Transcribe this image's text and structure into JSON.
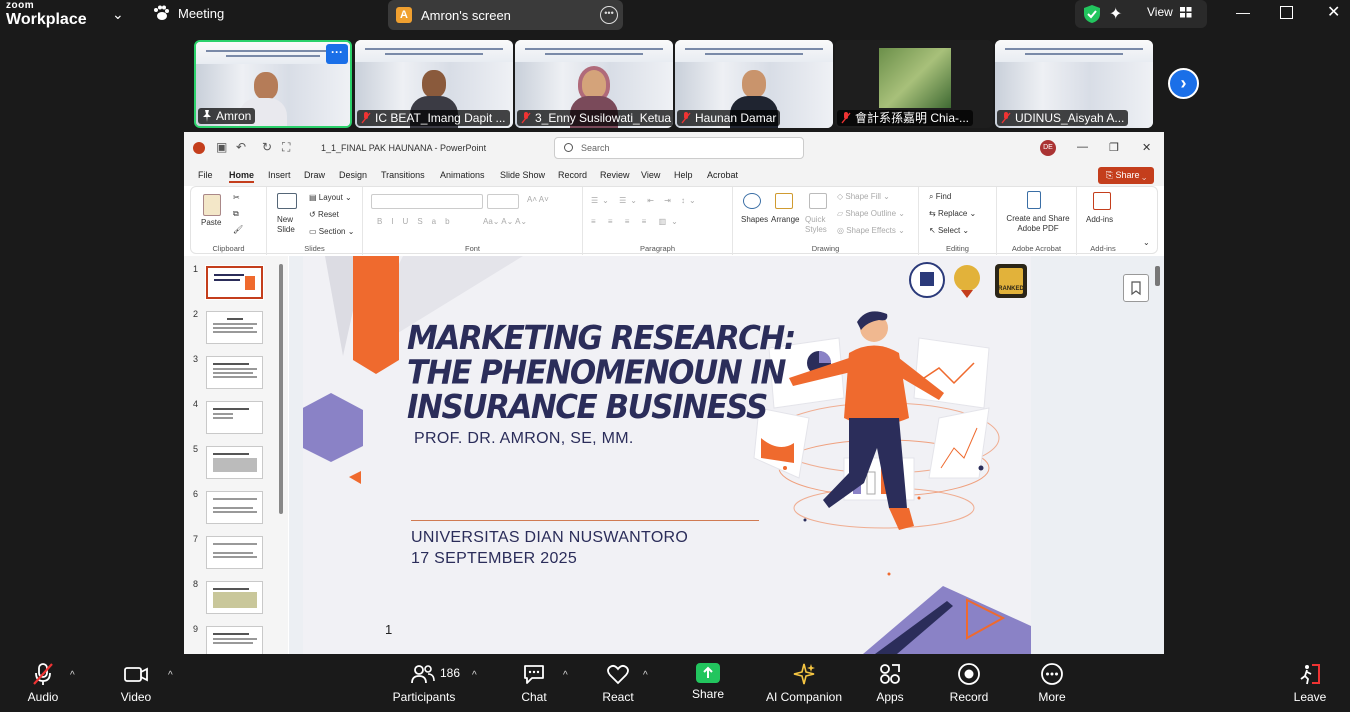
{
  "topbar": {
    "brand_small": "zoom",
    "brand_large": "Workplace",
    "meeting_label": "Meeting",
    "screen_avatar_letter": "A",
    "screen_label": "Amron's screen",
    "view_label": "View"
  },
  "participants": [
    {
      "name": "Amron",
      "pinned": true,
      "active": true
    },
    {
      "name": "IC BEAT_Imang Dapit ...",
      "muted": true
    },
    {
      "name": "3_Enny Susilowati_Ketua ...",
      "muted": true
    },
    {
      "name": "Haunan Damar",
      "muted": true
    },
    {
      "name": "會計系孫嘉明 Chia-...",
      "muted": true
    },
    {
      "name": "UDINUS_Aisyah A...",
      "muted": true
    }
  ],
  "active_menu_symbol": "···",
  "powerpoint": {
    "filename": "1_1_FINAL PAK HAUNANA  -  PowerPoint",
    "search_placeholder": "Search",
    "user_initials": "DE",
    "share_label": "Share",
    "menu_tabs": [
      "File",
      "Home",
      "Insert",
      "Draw",
      "Design",
      "Transitions",
      "Animations",
      "Slide Show",
      "Record",
      "Review",
      "View",
      "Help",
      "Acrobat"
    ],
    "ribbon": {
      "paste": "Paste",
      "clipboard": "Clipboard",
      "new_slide": "New Slide",
      "layout": "Layout",
      "reset": "Reset",
      "section": "Section",
      "slides": "Slides",
      "font": "Font",
      "paragraph": "Paragraph",
      "shapes": "Shapes",
      "arrange": "Arrange",
      "quick_styles": "Quick Styles",
      "shape_fill": "Shape Fill",
      "shape_outline": "Shape Outline",
      "shape_effects": "Shape Effects",
      "drawing": "Drawing",
      "find": "Find",
      "replace": "Replace",
      "select": "Select",
      "editing": "Editing",
      "create_share": "Create and Share Adobe PDF",
      "adobe_acrobat": "Adobe Acrobat",
      "add_ins": "Add-ins",
      "add_ins_group": "Add-ins"
    },
    "slide_numbers": [
      "1",
      "2",
      "3",
      "4",
      "5",
      "6",
      "7",
      "8",
      "9"
    ],
    "slide": {
      "title": "MARKETING RESEARCH: THE PHENOMENOUN IN INSURANCE BUSINESS",
      "author": "PROF. DR. AMRON, SE, MM.",
      "university": "UNIVERSITAS DIAN NUSWANTORO",
      "date": "17 SEPTEMBER 2025",
      "page": "1",
      "badge_text": "RANKED"
    }
  },
  "toolbar": {
    "audio": "Audio",
    "video": "Video",
    "participants": "Participants",
    "participants_count": "186",
    "chat": "Chat",
    "react": "React",
    "share": "Share",
    "ai_companion": "AI Companion",
    "apps": "Apps",
    "record": "Record",
    "more": "More",
    "leave": "Leave"
  },
  "colors": {
    "zoom_blue": "#1a6fe8",
    "active_green": "#2bd16b",
    "ppt_red": "#c43e1c",
    "share_green": "#22c55e",
    "slide_navy": "#2b2d5a",
    "slide_orange": "#ef6a2e",
    "slide_purple": "#8a82c6"
  }
}
